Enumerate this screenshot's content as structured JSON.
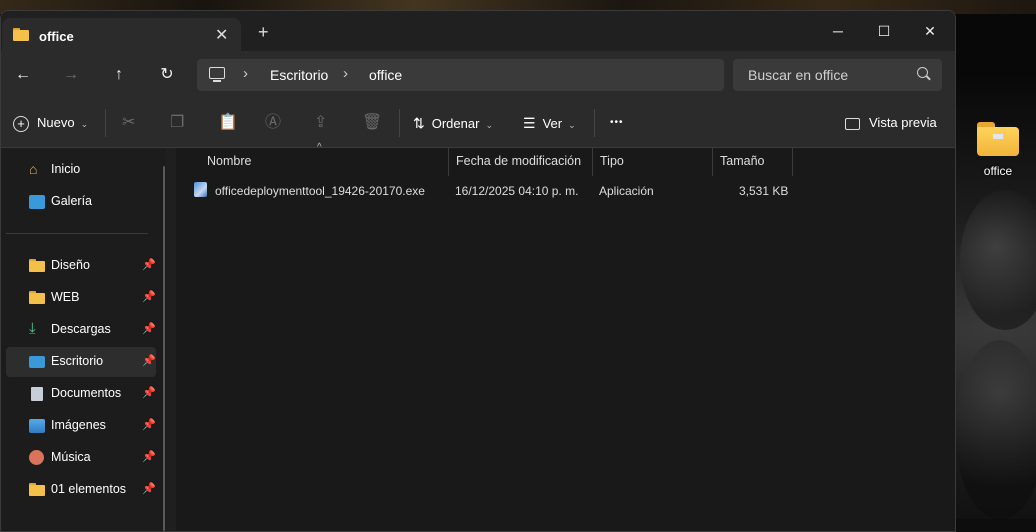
{
  "window": {
    "tab_title": "office"
  },
  "desktop": {
    "icon_label": "office"
  },
  "address": {
    "crumbs": [
      "Escritorio",
      "office"
    ]
  },
  "search": {
    "placeholder": "Buscar en office"
  },
  "toolbar": {
    "new_label": "Nuevo",
    "sort_label": "Ordenar",
    "view_label": "Ver",
    "preview_label": "Vista previa",
    "more": "•••"
  },
  "sidebar": {
    "items": [
      {
        "label": "Inicio",
        "icon": "home-icon"
      },
      {
        "label": "Galería",
        "icon": "gallery-icon"
      },
      {
        "label": "Diseño",
        "icon": "folder-icon",
        "pinned": true
      },
      {
        "label": "WEB",
        "icon": "folder-icon",
        "pinned": true
      },
      {
        "label": "Descargas",
        "icon": "download-icon",
        "pinned": true
      },
      {
        "label": "Escritorio",
        "icon": "desktop-icon",
        "pinned": true,
        "selected": true
      },
      {
        "label": "Documentos",
        "icon": "document-icon",
        "pinned": true
      },
      {
        "label": "Imágenes",
        "icon": "pictures-icon",
        "pinned": true
      },
      {
        "label": "Música",
        "icon": "music-icon",
        "pinned": true
      },
      {
        "label": "01 elementos",
        "icon": "folder-icon",
        "pinned": true
      }
    ]
  },
  "columns": [
    "Nombre",
    "Fecha de modificación",
    "Tipo",
    "Tamaño"
  ],
  "files": [
    {
      "name": "officedeploymenttool_19426-20170.exe",
      "modified": "16/12/2025 04:10 p. m.",
      "type": "Aplicación",
      "size": "3,531 KB"
    }
  ],
  "colors": {
    "accent_folder": "#f4c04a",
    "window_bg": "#1f1f1f",
    "chrome_bg": "#2b2b2b"
  }
}
